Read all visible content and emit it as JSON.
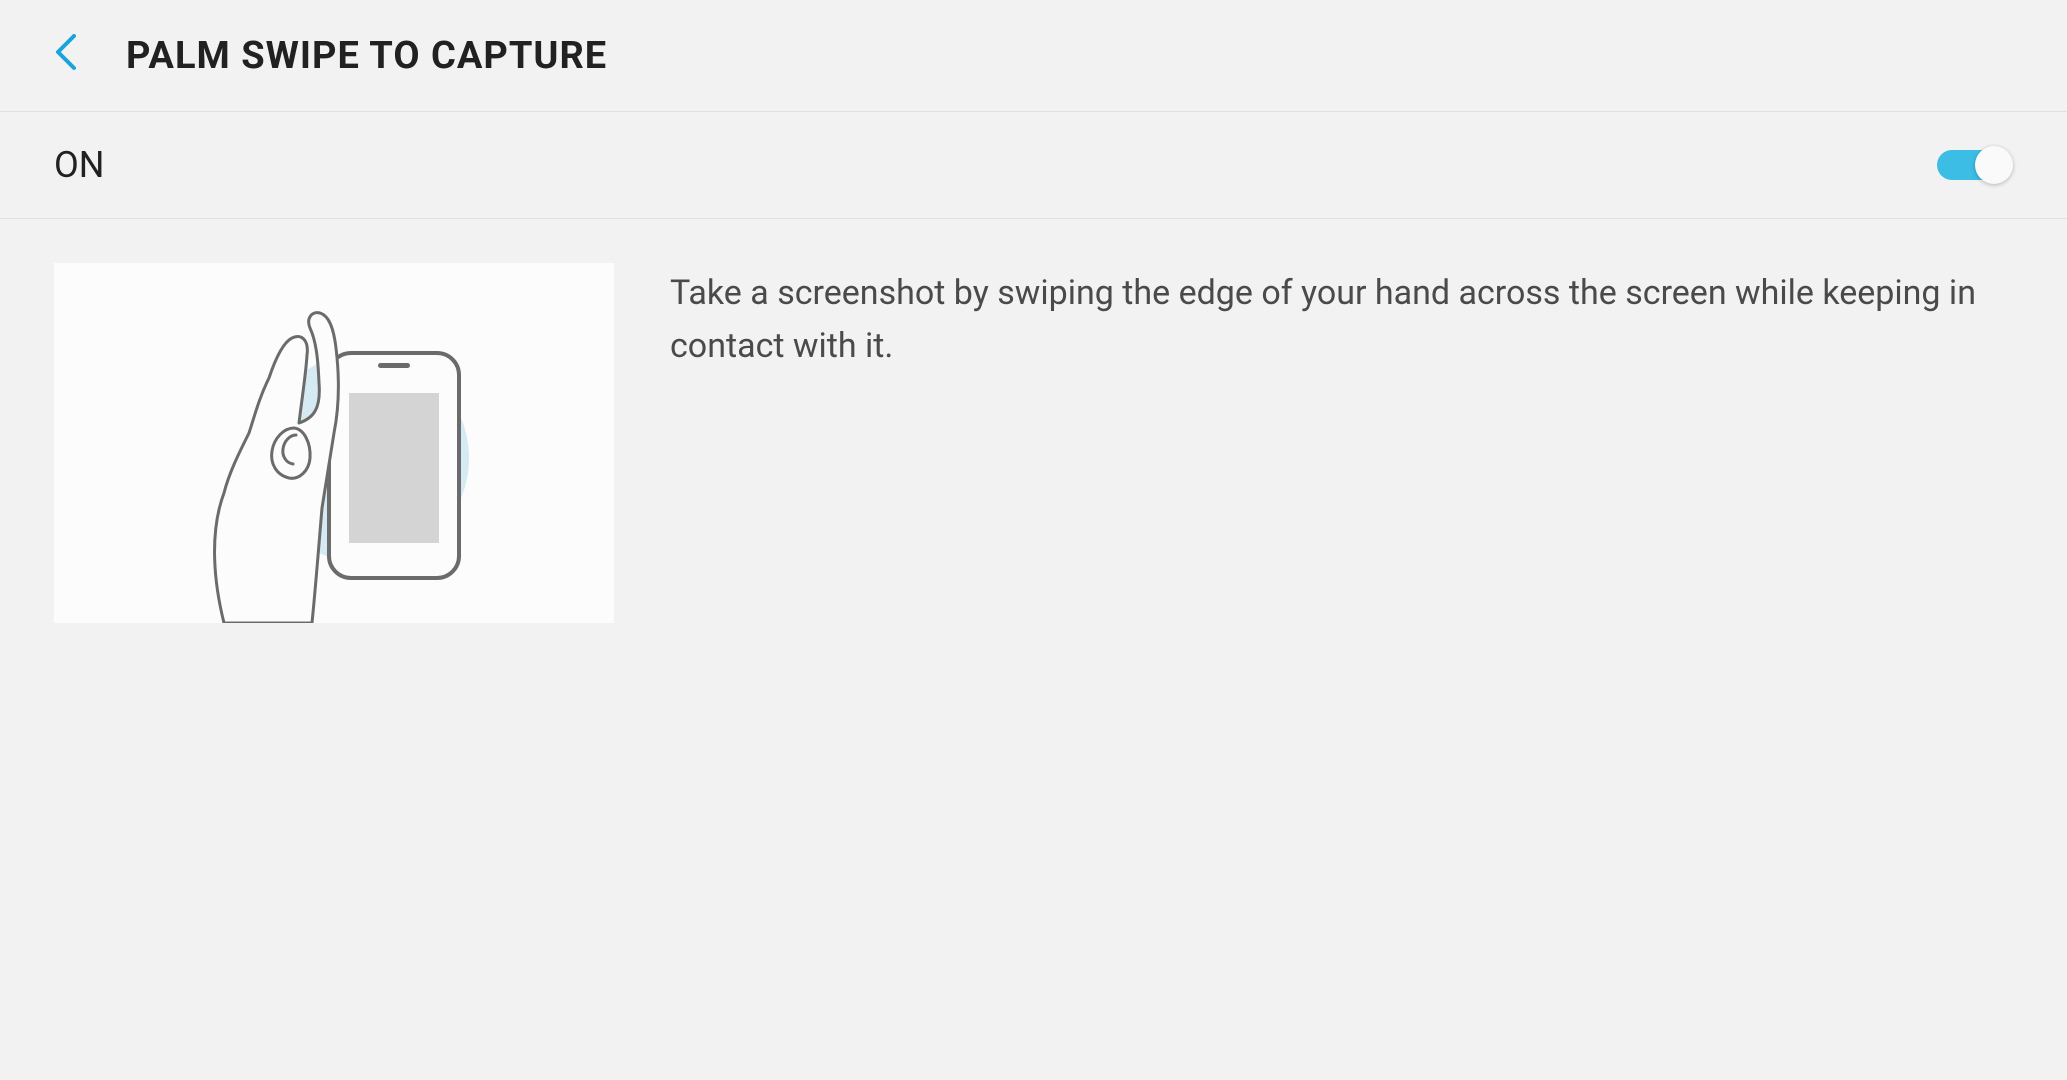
{
  "header": {
    "title": "PALM SWIPE TO CAPTURE"
  },
  "toggle": {
    "status_label": "ON",
    "enabled": true
  },
  "content": {
    "description": "Take a screenshot by swiping the edge of your hand across the screen while keeping in contact with it."
  }
}
